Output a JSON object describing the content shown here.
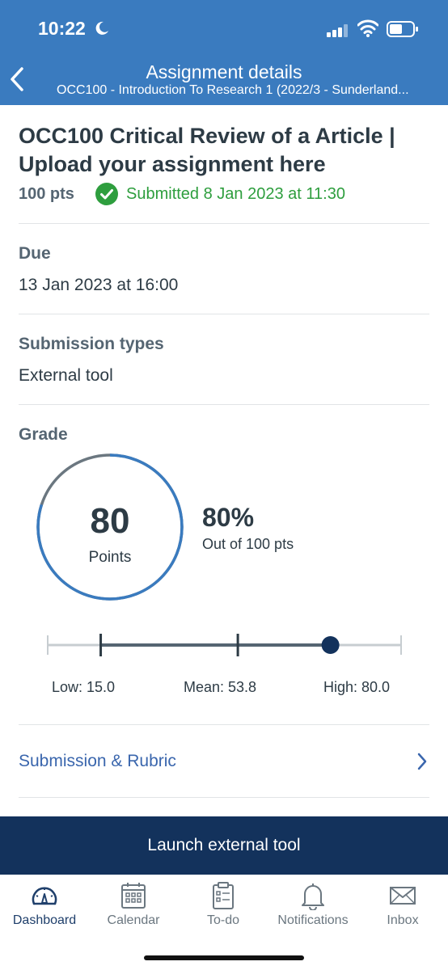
{
  "status_bar": {
    "time": "10:22"
  },
  "nav": {
    "title": "Assignment details",
    "subtitle": "OCC100 - Introduction To Research 1 (2022/3 - Sunderland..."
  },
  "assignment": {
    "title": "OCC100 Critical Review of a Article | Upload your assignment here",
    "points": "100 pts",
    "submission_status": "Submitted 8 Jan 2023 at 11:30"
  },
  "due": {
    "label": "Due",
    "value": "13 Jan 2023 at 16:00"
  },
  "submission_types": {
    "label": "Submission types",
    "value": "External tool"
  },
  "grade": {
    "label": "Grade",
    "score": "80",
    "unit": "Points",
    "percent": "80%",
    "out_of": "Out of 100 pts",
    "score_fraction": 0.8,
    "stats": {
      "low": "Low: 15.0",
      "mean": "Mean: 53.8",
      "high": "High: 80.0",
      "low_value": 15.0,
      "mean_value": 53.8,
      "high_value": 80.0,
      "score_value": 80.0,
      "max_value": 100
    }
  },
  "rubric": {
    "label": "Submission & Rubric"
  },
  "launch_button": "Launch external tool",
  "tabs": [
    {
      "label": "Dashboard",
      "icon": "dashboard-icon",
      "active": true
    },
    {
      "label": "Calendar",
      "icon": "calendar-icon"
    },
    {
      "label": "To-do",
      "icon": "todo-icon"
    },
    {
      "label": "Notifications",
      "icon": "bell-icon"
    },
    {
      "label": "Inbox",
      "icon": "envelope-icon"
    }
  ],
  "colors": {
    "header": "#3a7bbf",
    "accent": "#3a66ad",
    "success": "#2e9e3e",
    "launch": "#13325c"
  }
}
